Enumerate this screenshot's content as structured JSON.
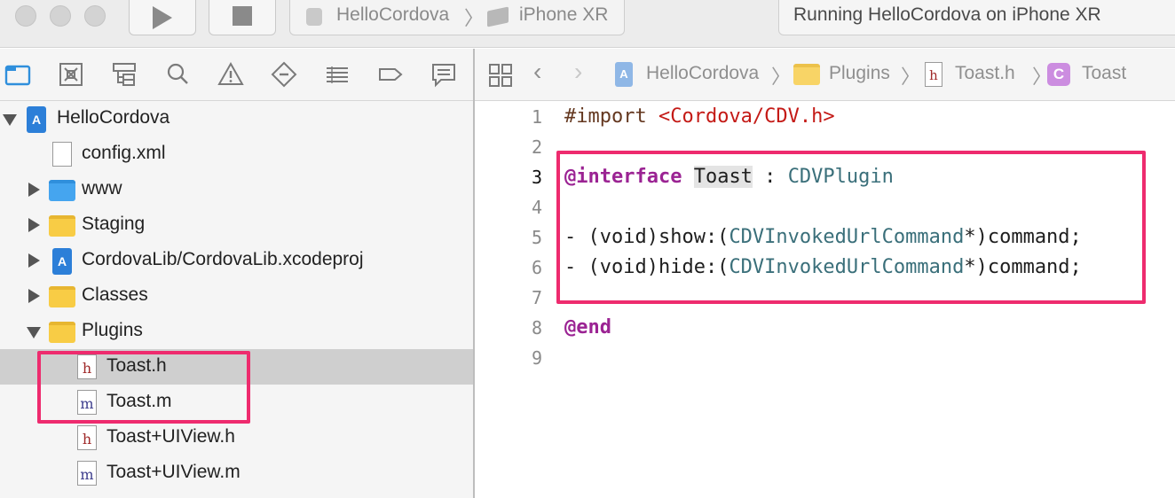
{
  "toolbar": {
    "scheme_app": "HelloCordova",
    "scheme_separator": "〉",
    "scheme_device": "iPhone XR",
    "status_text": "Running HelloCordova on iPhone XR"
  },
  "navigator": {
    "tabs": [
      "project-navigator",
      "source-control-navigator",
      "symbol-navigator",
      "find-navigator",
      "issue-navigator",
      "test-navigator",
      "debug-navigator",
      "breakpoint-navigator",
      "report-navigator"
    ],
    "tree": [
      {
        "label": "HelloCordova",
        "icon": "project-icon",
        "disclosure": "open"
      },
      {
        "label": "config.xml",
        "icon": "file-icon"
      },
      {
        "label": "www",
        "icon": "blue-folder-icon",
        "disclosure": "closed"
      },
      {
        "label": "Staging",
        "icon": "folder-icon",
        "disclosure": "closed"
      },
      {
        "label": "CordovaLib/CordovaLib.xcodeproj",
        "icon": "project-icon",
        "disclosure": "closed"
      },
      {
        "label": "Classes",
        "icon": "folder-icon",
        "disclosure": "closed"
      },
      {
        "label": "Plugins",
        "icon": "folder-icon",
        "disclosure": "open"
      },
      {
        "label": "Toast.h",
        "icon": "header-file-icon",
        "selected": true
      },
      {
        "label": "Toast.m",
        "icon": "implementation-file-icon"
      },
      {
        "label": "Toast+UIView.h",
        "icon": "header-file-icon"
      },
      {
        "label": "Toast+UIView.m",
        "icon": "implementation-file-icon"
      }
    ],
    "header_glyph": "h",
    "impl_glyph": "m"
  },
  "jumpbar": {
    "back": "‹",
    "forward": "›",
    "separator": "〉",
    "crumbs": [
      "HelloCordova",
      "Plugins",
      "Toast.h",
      "Toast"
    ],
    "class_badge": "C"
  },
  "editor": {
    "current_line": 3,
    "lines": [
      {
        "n": "1"
      },
      {
        "n": "2"
      },
      {
        "n": "3"
      },
      {
        "n": "4"
      },
      {
        "n": "5"
      },
      {
        "n": "6"
      },
      {
        "n": "7"
      },
      {
        "n": "8"
      },
      {
        "n": "9"
      }
    ],
    "code": {
      "l1_directive": "#import",
      "l1_path": "<Cordova/CDV.h>",
      "l3_keyword": "@interface",
      "l3_class": "Toast",
      "l3_colon": " : ",
      "l3_super": "CDVPlugin",
      "l5_prefix": "- (void)show:(",
      "l5_type": "CDVInvokedUrlCommand",
      "l5_suffix": "*)command;",
      "l6_prefix": "- (void)hide:(",
      "l6_type": "CDVInvokedUrlCommand",
      "l6_suffix": "*)command;",
      "l8_keyword": "@end"
    }
  },
  "colors": {
    "highlight": "#ee2b6e",
    "keyword": "#9b2393",
    "string": "#c41a16",
    "type": "#3a6f7a"
  }
}
